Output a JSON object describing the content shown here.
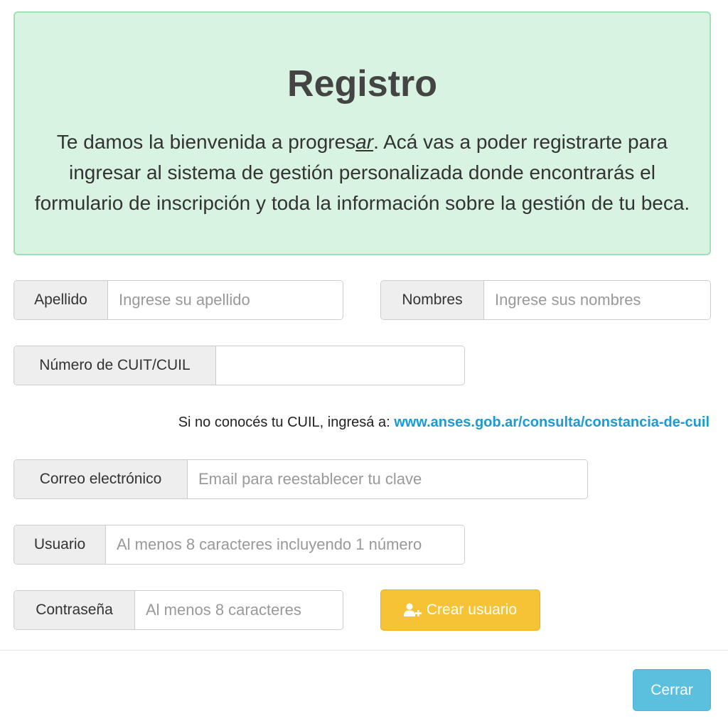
{
  "banner": {
    "title": "Registro",
    "text_before": "Te damos la bienvenida a progres",
    "brand_suffix": "ar",
    "text_after": ". Acá vas a poder registrarte para ingresar al sistema de gestión personalizada donde encontrarás el formulario de inscripción y toda la información sobre la gestión de tu beca."
  },
  "form": {
    "apellido": {
      "label": "Apellido",
      "placeholder": "Ingrese su apellido",
      "value": ""
    },
    "nombres": {
      "label": "Nombres",
      "placeholder": "Ingrese sus nombres",
      "value": ""
    },
    "cuit": {
      "label": "Número de CUIT/CUIL",
      "placeholder": "",
      "value": ""
    },
    "cuil_help": {
      "text": "Si no conocés tu CUIL, ingresá a: ",
      "link": "www.anses.gob.ar/consulta/constancia-de-cuil"
    },
    "email": {
      "label": "Correo electrónico",
      "placeholder": "Email para reestablecer tu clave",
      "value": ""
    },
    "usuario": {
      "label": "Usuario",
      "placeholder": "Al menos 8 caracteres incluyendo 1 número",
      "value": ""
    },
    "password": {
      "label": "Contraseña",
      "placeholder": "Al menos 8 caracteres",
      "value": ""
    }
  },
  "buttons": {
    "create_user": {
      "label": "Crear usuario",
      "icon": "user-plus-icon",
      "color": "#f7c336"
    },
    "close": {
      "label": "Cerrar",
      "color": "#5bc0de"
    }
  },
  "colors": {
    "banner_bg": "#d8f3e2",
    "banner_border": "#9fe0b5",
    "link": "#1a9ad6"
  }
}
